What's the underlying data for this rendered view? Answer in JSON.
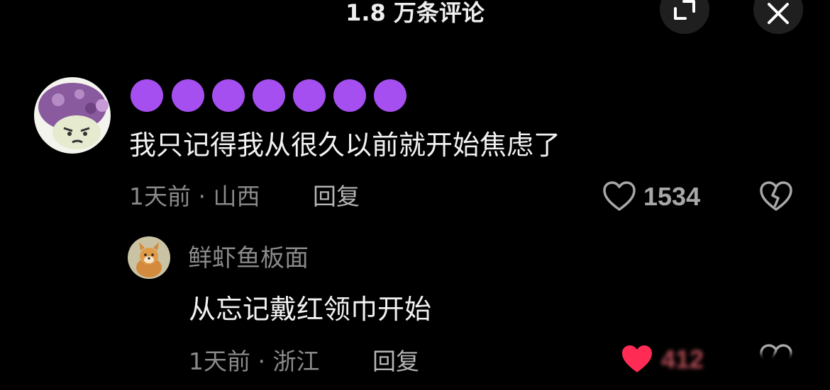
{
  "header": {
    "title": "1.8 万条评论",
    "expand_icon": "expand-icon",
    "close_icon": "close-icon"
  },
  "comments": [
    {
      "avatar_icon": "mushroom-avatar",
      "username": "🟣🟣🟣🟣🟣🟣🟣",
      "text": "我只记得我从很久以前就开始焦虑了",
      "meta": "1天前 · 山西",
      "reply_label": "回复",
      "like_count": "1534",
      "like_icon": "heart-outline-icon",
      "dislike_icon": "broken-heart-icon",
      "liked": false
    },
    {
      "avatar_icon": "dog-avatar",
      "username": "鲜虾鱼板面",
      "text": "从忘记戴红领巾开始",
      "meta": "1天前 · 浙江",
      "reply_label": "回复",
      "like_count": "412",
      "like_icon": "heart-filled-icon",
      "dislike_icon": "broken-heart-icon",
      "liked": true
    }
  ],
  "colors": {
    "background": "#000000",
    "like_active": "#fe2c55",
    "muted_text": "#8a8a8a",
    "emoji_purple": "#a64ff0"
  }
}
